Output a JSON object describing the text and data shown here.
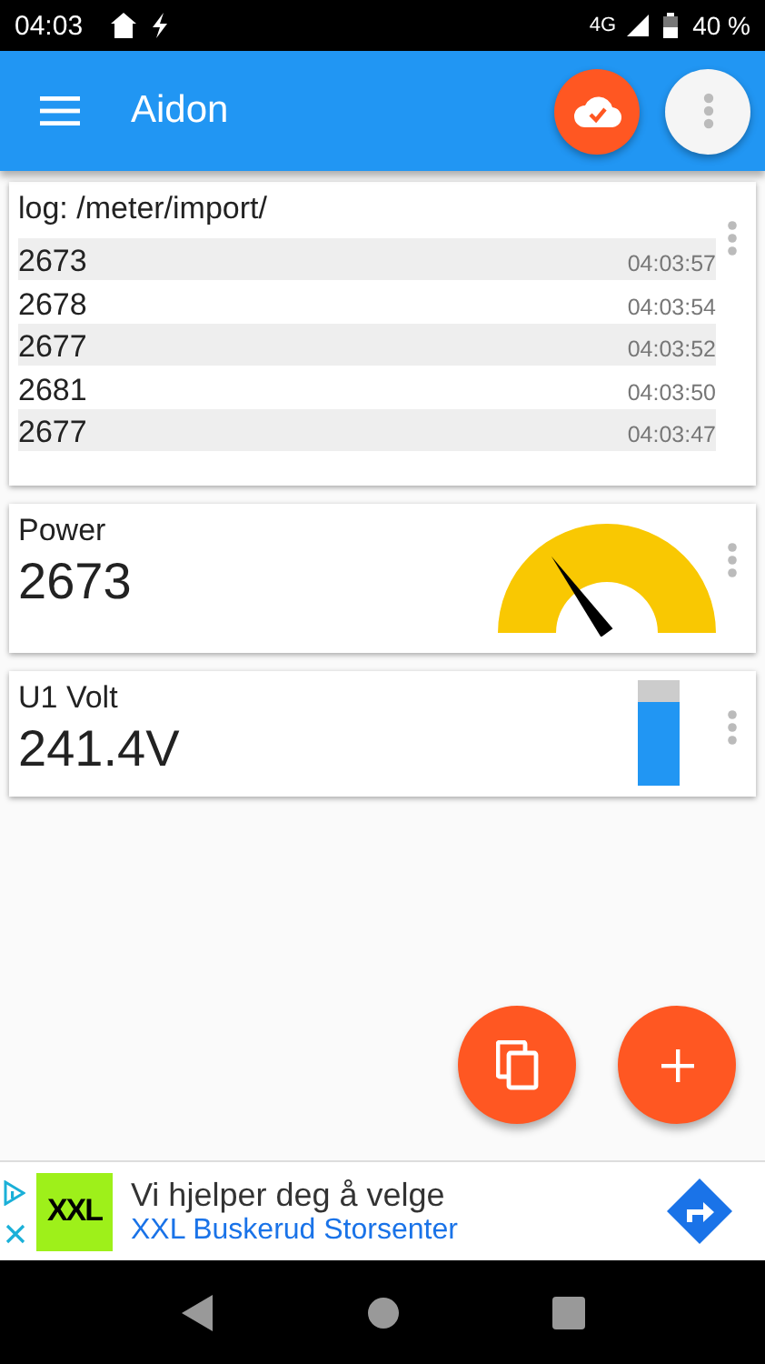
{
  "status_bar": {
    "time": "04:03",
    "network": "4G",
    "battery": "40 %"
  },
  "app_bar": {
    "title": "Aidon"
  },
  "log_card": {
    "title": "log: /meter/import/",
    "rows": [
      {
        "value": "2673",
        "time": "04:03:57"
      },
      {
        "value": "2678",
        "time": "04:03:54"
      },
      {
        "value": "2677",
        "time": "04:03:52"
      },
      {
        "value": "2681",
        "time": "04:03:50"
      },
      {
        "value": "2677",
        "time": "04:03:47"
      }
    ]
  },
  "widgets": [
    {
      "kind": "gauge",
      "label": "Power",
      "value": "2673"
    },
    {
      "kind": "bar",
      "label": "U1 Volt",
      "value": "241.4V",
      "level": 0.8
    }
  ],
  "ad": {
    "headline": "Vi hjelper deg å velge",
    "advertiser": "XXL Buskerud Storsenter",
    "logo": "XXL"
  }
}
